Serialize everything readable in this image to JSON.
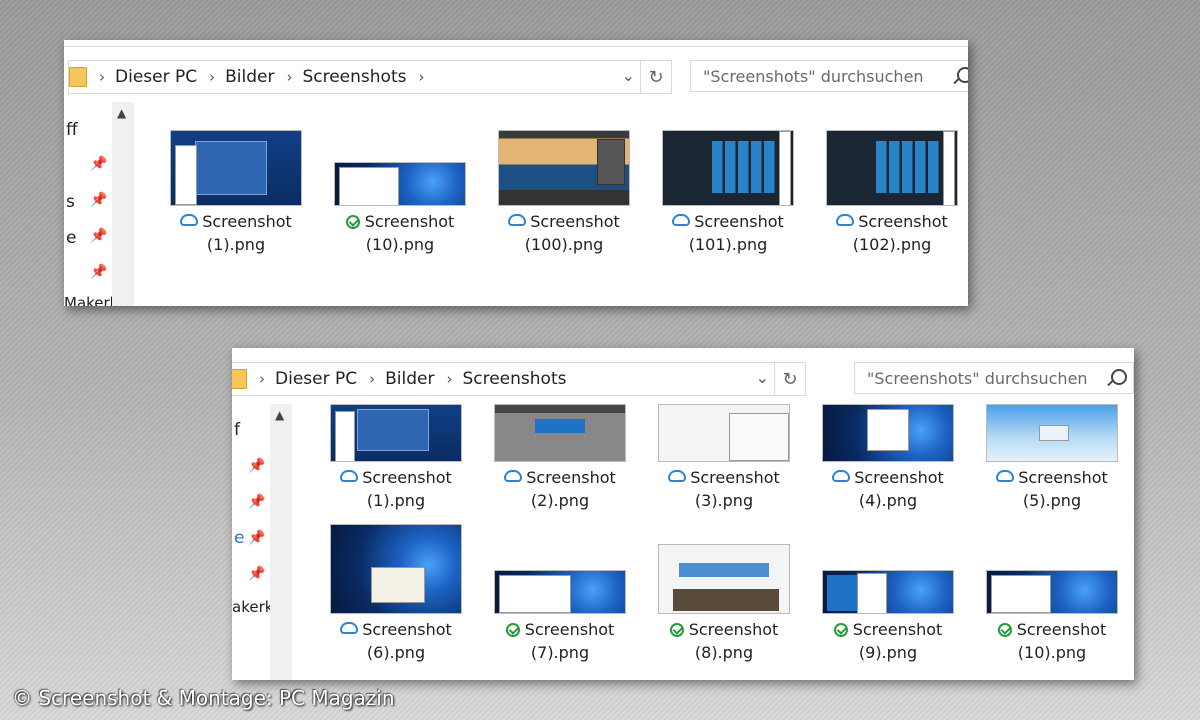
{
  "top_window": {
    "breadcrumb": [
      "Dieser PC",
      "Bilder",
      "Screenshots"
    ],
    "search_placeholder": "\"Screenshots\" durchsuchen",
    "nav_labels": [
      "ff",
      "s",
      "e",
      "Makerk"
    ],
    "files": [
      {
        "line1": "Screenshot",
        "line2": "(1).png",
        "status": "cloud"
      },
      {
        "line1": "Screenshot",
        "line2": "(10).png",
        "status": "synced"
      },
      {
        "line1": "Screenshot",
        "line2": "(100).png",
        "status": "cloud"
      },
      {
        "line1": "Screenshot",
        "line2": "(101).png",
        "status": "cloud"
      },
      {
        "line1": "Screenshot",
        "line2": "(102).png",
        "status": "cloud"
      }
    ]
  },
  "bottom_window": {
    "breadcrumb": [
      "Dieser PC",
      "Bilder",
      "Screenshots"
    ],
    "search_placeholder": "\"Screenshots\" durchsuchen",
    "nav_labels": [
      "f",
      "e",
      "akerk"
    ],
    "files": [
      {
        "line1": "Screenshot",
        "line2": "(1).png",
        "status": "cloud"
      },
      {
        "line1": "Screenshot",
        "line2": "(2).png",
        "status": "cloud"
      },
      {
        "line1": "Screenshot",
        "line2": "(3).png",
        "status": "cloud"
      },
      {
        "line1": "Screenshot",
        "line2": "(4).png",
        "status": "cloud"
      },
      {
        "line1": "Screenshot",
        "line2": "(5).png",
        "status": "cloud"
      },
      {
        "line1": "Screenshot",
        "line2": "(6).png",
        "status": "cloud"
      },
      {
        "line1": "Screenshot",
        "line2": "(7).png",
        "status": "synced"
      },
      {
        "line1": "Screenshot",
        "line2": "(8).png",
        "status": "synced"
      },
      {
        "line1": "Screenshot",
        "line2": "(9).png",
        "status": "synced"
      },
      {
        "line1": "Screenshot",
        "line2": "(10).png",
        "status": "synced"
      }
    ]
  },
  "copyright": "© Screenshot & Montage: PC Magazin",
  "colors": {
    "cloud": "#2b82d9",
    "synced": "#2a9a3c",
    "folder": "#f6c65b"
  }
}
